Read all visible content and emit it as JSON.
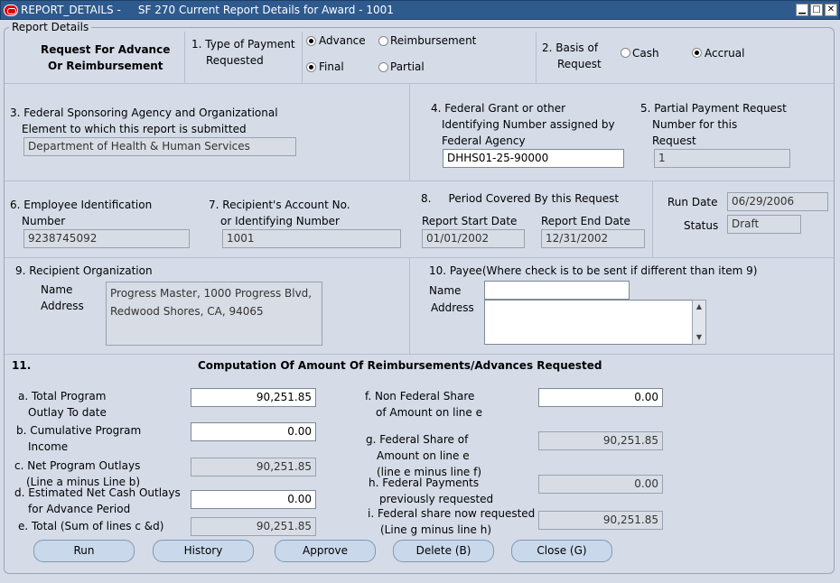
{
  "window": {
    "title": "REPORT_DETAILS -     SF 270 Current Report Details for Award - 1001",
    "minimize": "▁",
    "maximize": "□",
    "close": "✕"
  },
  "section_title": "Report Details",
  "header": {
    "request_title_1": "Request For Advance",
    "request_title_2": "Or Reimbursement",
    "type_label_1": "1. Type of Payment",
    "type_label_2": "Requested",
    "advance": "Advance",
    "reimbursement": "Reimbursement",
    "final": "Final",
    "partial": "Partial",
    "basis_label_1": "2. Basis of",
    "basis_label_2": "Request",
    "cash": "Cash",
    "accrual": "Accrual"
  },
  "agency": {
    "label_1": "3. Federal Sponsoring Agency and Organizational",
    "label_2": "Element to which this report is submitted",
    "value": "Department of Health & Human Services",
    "grant_label_1": "4. Federal Grant or other",
    "grant_label_2": "Identifying Number assigned by",
    "grant_label_3": "Federal Agency",
    "grant_value": "DHHS01-25-90000",
    "partial_label_1": "5. Partial Payment Request",
    "partial_label_2": "Number for this",
    "partial_label_3": "Request",
    "partial_value": "1"
  },
  "ids": {
    "ein_label_1": "6. Employee Identification",
    "ein_label_2": "Number",
    "ein_value": "9238745092",
    "acct_label_1": "7. Recipient's Account No.",
    "acct_label_2": "or Identifying Number",
    "acct_value": "1001",
    "period_label": "8.     Period Covered By this Request",
    "start_label": "Report Start Date",
    "start_value": "01/01/2002",
    "end_label": "Report End Date",
    "end_value": "12/31/2002",
    "run_date_label": "Run Date",
    "run_date_value": "06/29/2006",
    "status_label": "Status",
    "status_value": "Draft"
  },
  "recipient": {
    "label": "9. Recipient Organization",
    "name_label": "Name",
    "address_label": "Address",
    "line_1": "Progress Master,  1000 Progress Blvd,",
    "line_2": "Redwood Shores,  CA,  94065",
    "payee_label": "10. Payee(Where check is to be sent if different than item 9)",
    "payee_name_label": "Name",
    "payee_address_label": "Address",
    "payee_name_value": "",
    "payee_address_value": ""
  },
  "computation": {
    "number": "11.",
    "title": "Computation Of Amount Of Reimbursements/Advances Requested",
    "a_1": "a. Total Program",
    "a_2": "Outlay To date",
    "a_value": "90,251.85",
    "b_1": "b. Cumulative Program",
    "b_2": "Income",
    "b_value": "0.00",
    "c_1": "c. Net Program Outlays",
    "c_2": "(Line a minus Line b)",
    "c_value": "90,251.85",
    "d_1": "d. Estimated Net Cash Outlays",
    "d_2": "for Advance Period",
    "d_value": "0.00",
    "e_1": "e. Total (Sum of lines c &d)",
    "e_value": "90,251.85",
    "f_1": "f. Non Federal Share",
    "f_2": "of Amount on line e",
    "f_value": "0.00",
    "g_1": "g. Federal Share of",
    "g_2": "Amount on line e",
    "g_3": "(line e minus line f)",
    "g_value": "90,251.85",
    "h_1": "h. Federal Payments",
    "h_2": "previously requested",
    "h_value": "0.00",
    "i_1": "i. Federal share now requested",
    "i_2": "(Line g minus line h)",
    "i_value": "90,251.85"
  },
  "buttons": {
    "run": "Run",
    "history": "History",
    "approve": "Approve",
    "delete": "Delete (B)",
    "close": "Close (G)"
  }
}
